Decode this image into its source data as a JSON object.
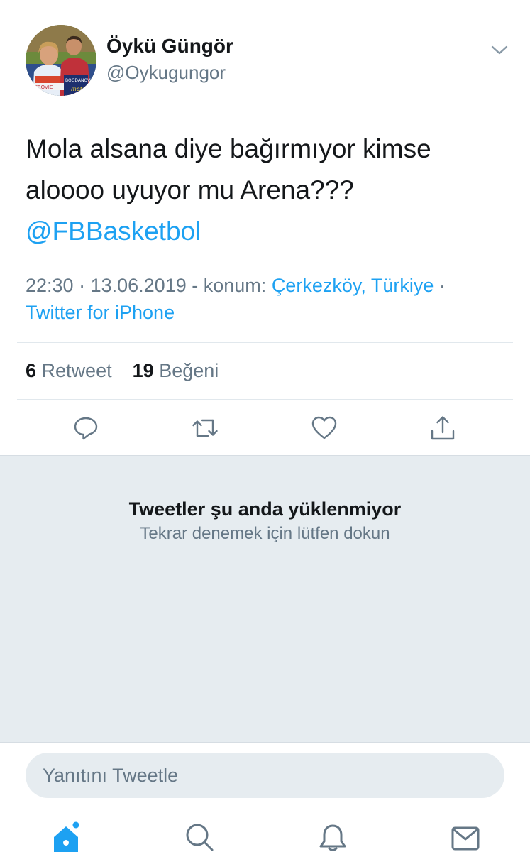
{
  "tweet": {
    "author_name": "Öykü Güngör",
    "author_handle": "@Oykugungor",
    "text_line1": "Mola alsana diye bağırmıyor kimse",
    "text_line2": "aloooo uyuyor mu Arena???",
    "mention": "@FBBasketbol",
    "time": "22:30",
    "date": "13.06.2019",
    "location_prefix": "konum:",
    "location": "Çerkezköy, Türkiye",
    "client": "Twitter for iPhone",
    "retweet_count": "6",
    "retweet_label": "Retweet",
    "like_count": "19",
    "like_label": "Beğeni",
    "avatar_jersey_texts": [
      "ETROVIC",
      "BOGDANOVIC",
      "metro"
    ]
  },
  "error": {
    "title": "Tweetler şu anda yüklenmiyor",
    "subtitle": "Tekrar denemek için lütfen dokun"
  },
  "reply": {
    "placeholder": "Yanıtını Tweetle"
  },
  "icons": {
    "caret": "chevron-down-icon",
    "reply": "reply-icon",
    "retweet": "retweet-icon",
    "like": "heart-icon",
    "share": "share-icon",
    "home": "home-icon",
    "search": "search-icon",
    "notifications": "bell-icon",
    "messages": "envelope-icon"
  },
  "colors": {
    "accent": "#1da1f2",
    "secondary_text": "#657786",
    "error_background": "#e6ecf0"
  }
}
